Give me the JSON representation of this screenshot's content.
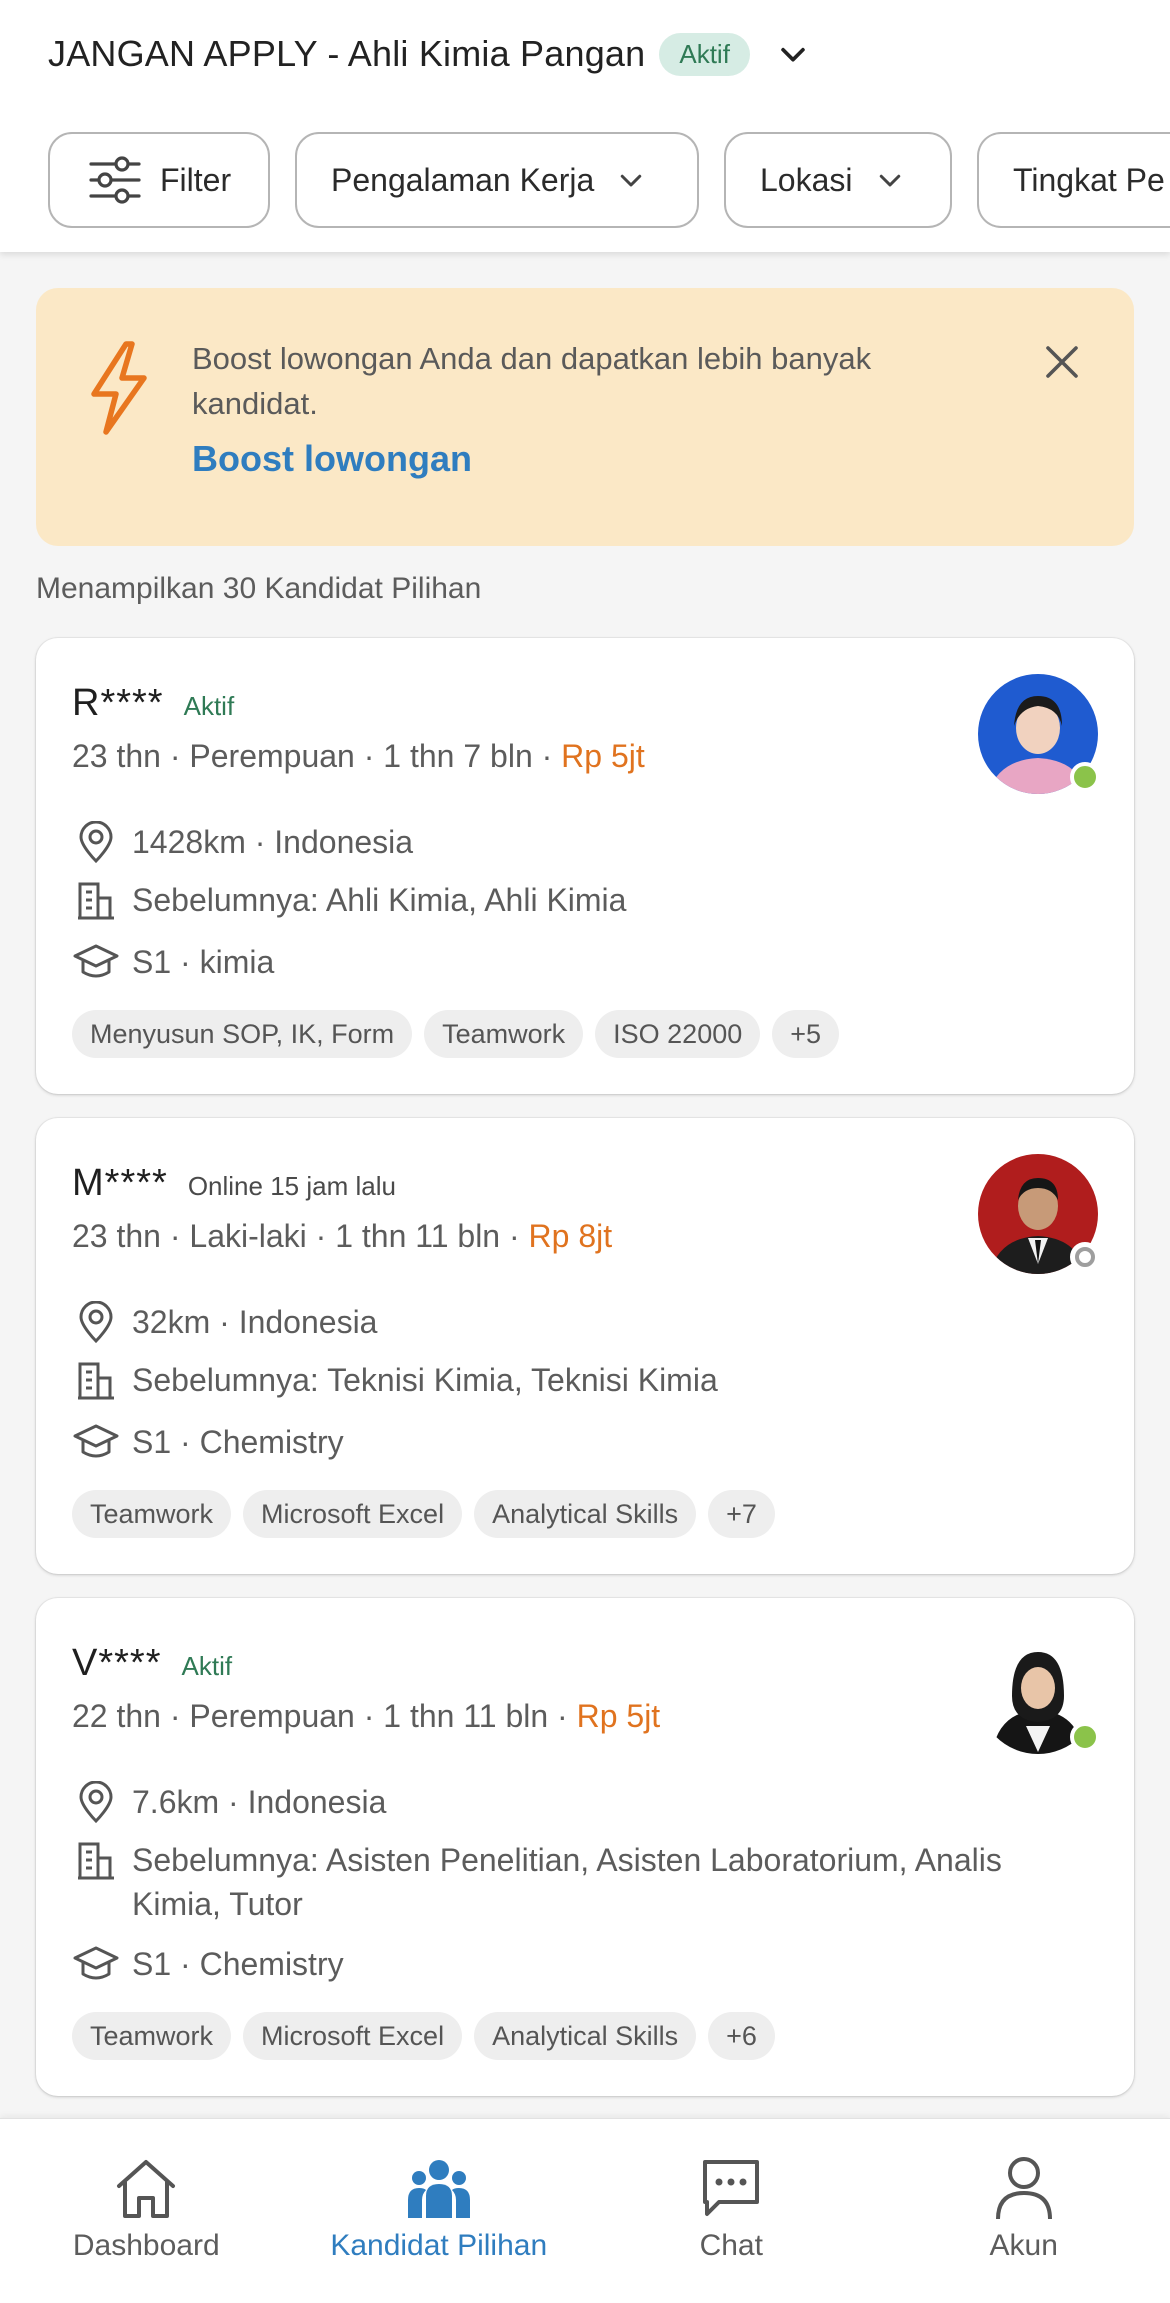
{
  "header": {
    "job_title": "JANGAN APPLY - Ahli Kimia Pangan",
    "job_status": "Aktif",
    "filters": [
      {
        "label": "Filter",
        "icon": "sliders-icon"
      },
      {
        "label": "Pengalaman Kerja"
      },
      {
        "label": "Lokasi"
      },
      {
        "label": "Tingkat Pe"
      }
    ]
  },
  "boost": {
    "text": "Boost lowongan Anda dan dapatkan lebih banyak kandidat.",
    "link": "Boost lowongan",
    "icon": "lightning-icon"
  },
  "count_label": "Menampilkan 30 Kandidat Pilihan",
  "candidates": [
    {
      "name": "R****",
      "status": "Aktif",
      "online": true,
      "meta": "23 thn · Perempuan · 1 thn 7 bln · ",
      "salary": "Rp 5jt",
      "location": "1428km · Indonesia",
      "previous": "Sebelumnya: Ahli Kimia, Ahli Kimia",
      "education": "S1 · kimia",
      "tags": [
        "Menyusun SOP, IK, Form",
        "Teamwork",
        "ISO 22000",
        "+5"
      ]
    },
    {
      "name": "M****",
      "status": "Online 15 jam lalu",
      "online": false,
      "meta": "23 thn · Laki-laki · 1 thn 11 bln · ",
      "salary": "Rp 8jt",
      "location": "32km · Indonesia",
      "previous": "Sebelumnya: Teknisi Kimia, Teknisi Kimia",
      "education": "S1 · Chemistry",
      "tags": [
        "Teamwork",
        "Microsoft Excel",
        "Analytical Skills",
        "+7"
      ]
    },
    {
      "name": "V****",
      "status": "Aktif",
      "online": true,
      "meta": "22 thn · Perempuan · 1 thn 11 bln · ",
      "salary": "Rp 5jt",
      "location": "7.6km · Indonesia",
      "previous": "Sebelumnya: Asisten Penelitian, Asisten Laboratorium, Analis Kimia, Tutor",
      "education": "S1 · Chemistry",
      "tags": [
        "Teamwork",
        "Microsoft Excel",
        "Analytical Skills",
        "+6"
      ]
    }
  ],
  "nav": [
    {
      "label": "Dashboard",
      "icon": "home-icon",
      "active": false
    },
    {
      "label": "Kandidat Pilihan",
      "icon": "people-icon",
      "active": true
    },
    {
      "label": "Chat",
      "icon": "chat-icon",
      "active": false
    },
    {
      "label": "Akun",
      "icon": "user-icon",
      "active": false
    }
  ],
  "colors": {
    "accent": "#2f7dbf",
    "salary": "#e0731f",
    "active_status": "#2f7a55",
    "boost_bg": "#fbe8c6",
    "online_dot": "#8bc34a"
  }
}
